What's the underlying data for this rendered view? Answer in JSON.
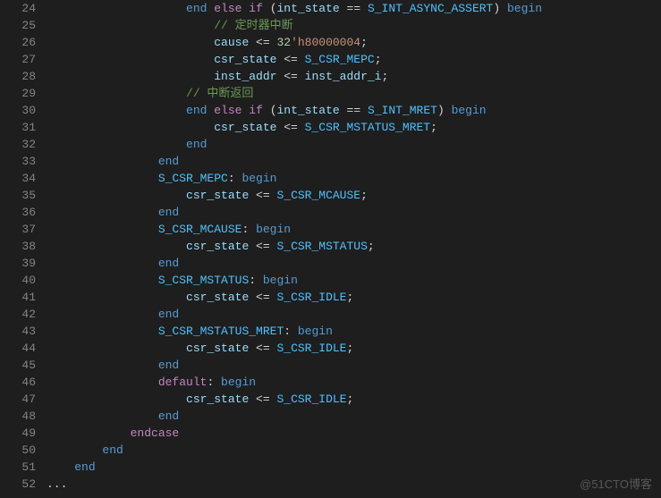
{
  "watermark": "@51CTO博客",
  "lines": [
    {
      "num": "24",
      "tokens": [
        {
          "t": "                    ",
          "c": "op"
        },
        {
          "t": "end",
          "c": "kw-blue"
        },
        {
          "t": " ",
          "c": "op"
        },
        {
          "t": "else",
          "c": "kw-pink"
        },
        {
          "t": " ",
          "c": "op"
        },
        {
          "t": "if",
          "c": "kw-pink"
        },
        {
          "t": " (",
          "c": "op"
        },
        {
          "t": "int_state",
          "c": "ident"
        },
        {
          "t": " == ",
          "c": "op"
        },
        {
          "t": "S_INT_ASYNC_ASSERT",
          "c": "const"
        },
        {
          "t": ") ",
          "c": "op"
        },
        {
          "t": "begin",
          "c": "kw-blue"
        }
      ]
    },
    {
      "num": "25",
      "tokens": [
        {
          "t": "                        ",
          "c": "op"
        },
        {
          "t": "// 定时器中断",
          "c": "comment"
        }
      ]
    },
    {
      "num": "26",
      "tokens": [
        {
          "t": "                        ",
          "c": "op"
        },
        {
          "t": "cause",
          "c": "ident"
        },
        {
          "t": " <= ",
          "c": "op"
        },
        {
          "t": "32",
          "c": "num"
        },
        {
          "t": "'h80000004",
          "c": "str"
        },
        {
          "t": ";",
          "c": "op"
        }
      ]
    },
    {
      "num": "27",
      "tokens": [
        {
          "t": "                        ",
          "c": "op"
        },
        {
          "t": "csr_state",
          "c": "ident"
        },
        {
          "t": " <= ",
          "c": "op"
        },
        {
          "t": "S_CSR_MEPC",
          "c": "const"
        },
        {
          "t": ";",
          "c": "op"
        }
      ]
    },
    {
      "num": "28",
      "tokens": [
        {
          "t": "                        ",
          "c": "op"
        },
        {
          "t": "inst_addr",
          "c": "ident"
        },
        {
          "t": " <= ",
          "c": "op"
        },
        {
          "t": "inst_addr_i",
          "c": "ident"
        },
        {
          "t": ";",
          "c": "op"
        }
      ]
    },
    {
      "num": "29",
      "tokens": [
        {
          "t": "                    ",
          "c": "op"
        },
        {
          "t": "// 中断返回",
          "c": "comment"
        }
      ]
    },
    {
      "num": "30",
      "tokens": [
        {
          "t": "                    ",
          "c": "op"
        },
        {
          "t": "end",
          "c": "kw-blue"
        },
        {
          "t": " ",
          "c": "op"
        },
        {
          "t": "else",
          "c": "kw-pink"
        },
        {
          "t": " ",
          "c": "op"
        },
        {
          "t": "if",
          "c": "kw-pink"
        },
        {
          "t": " (",
          "c": "op"
        },
        {
          "t": "int_state",
          "c": "ident"
        },
        {
          "t": " == ",
          "c": "op"
        },
        {
          "t": "S_INT_MRET",
          "c": "const"
        },
        {
          "t": ") ",
          "c": "op"
        },
        {
          "t": "begin",
          "c": "kw-blue"
        }
      ]
    },
    {
      "num": "31",
      "tokens": [
        {
          "t": "                        ",
          "c": "op"
        },
        {
          "t": "csr_state",
          "c": "ident"
        },
        {
          "t": " <= ",
          "c": "op"
        },
        {
          "t": "S_CSR_MSTATUS_MRET",
          "c": "const"
        },
        {
          "t": ";",
          "c": "op"
        }
      ]
    },
    {
      "num": "32",
      "tokens": [
        {
          "t": "                    ",
          "c": "op"
        },
        {
          "t": "end",
          "c": "kw-blue"
        }
      ]
    },
    {
      "num": "33",
      "tokens": [
        {
          "t": "                ",
          "c": "op"
        },
        {
          "t": "end",
          "c": "kw-blue"
        }
      ]
    },
    {
      "num": "34",
      "tokens": [
        {
          "t": "                ",
          "c": "op"
        },
        {
          "t": "S_CSR_MEPC",
          "c": "const"
        },
        {
          "t": ": ",
          "c": "op"
        },
        {
          "t": "begin",
          "c": "kw-blue"
        }
      ]
    },
    {
      "num": "35",
      "tokens": [
        {
          "t": "                    ",
          "c": "op"
        },
        {
          "t": "csr_state",
          "c": "ident"
        },
        {
          "t": " <= ",
          "c": "op"
        },
        {
          "t": "S_CSR_MCAUSE",
          "c": "const"
        },
        {
          "t": ";",
          "c": "op"
        }
      ]
    },
    {
      "num": "36",
      "tokens": [
        {
          "t": "                ",
          "c": "op"
        },
        {
          "t": "end",
          "c": "kw-blue"
        }
      ]
    },
    {
      "num": "37",
      "tokens": [
        {
          "t": "                ",
          "c": "op"
        },
        {
          "t": "S_CSR_MCAUSE",
          "c": "const"
        },
        {
          "t": ": ",
          "c": "op"
        },
        {
          "t": "begin",
          "c": "kw-blue"
        }
      ]
    },
    {
      "num": "38",
      "tokens": [
        {
          "t": "                    ",
          "c": "op"
        },
        {
          "t": "csr_state",
          "c": "ident"
        },
        {
          "t": " <= ",
          "c": "op"
        },
        {
          "t": "S_CSR_MSTATUS",
          "c": "const"
        },
        {
          "t": ";",
          "c": "op"
        }
      ]
    },
    {
      "num": "39",
      "tokens": [
        {
          "t": "                ",
          "c": "op"
        },
        {
          "t": "end",
          "c": "kw-blue"
        }
      ]
    },
    {
      "num": "40",
      "tokens": [
        {
          "t": "                ",
          "c": "op"
        },
        {
          "t": "S_CSR_MSTATUS",
          "c": "const"
        },
        {
          "t": ": ",
          "c": "op"
        },
        {
          "t": "begin",
          "c": "kw-blue"
        }
      ]
    },
    {
      "num": "41",
      "tokens": [
        {
          "t": "                    ",
          "c": "op"
        },
        {
          "t": "csr_state",
          "c": "ident"
        },
        {
          "t": " <= ",
          "c": "op"
        },
        {
          "t": "S_CSR_IDLE",
          "c": "const"
        },
        {
          "t": ";",
          "c": "op"
        }
      ]
    },
    {
      "num": "42",
      "tokens": [
        {
          "t": "                ",
          "c": "op"
        },
        {
          "t": "end",
          "c": "kw-blue"
        }
      ]
    },
    {
      "num": "43",
      "tokens": [
        {
          "t": "                ",
          "c": "op"
        },
        {
          "t": "S_CSR_MSTATUS_MRET",
          "c": "const"
        },
        {
          "t": ": ",
          "c": "op"
        },
        {
          "t": "begin",
          "c": "kw-blue"
        }
      ]
    },
    {
      "num": "44",
      "tokens": [
        {
          "t": "                    ",
          "c": "op"
        },
        {
          "t": "csr_state",
          "c": "ident"
        },
        {
          "t": " <= ",
          "c": "op"
        },
        {
          "t": "S_CSR_IDLE",
          "c": "const"
        },
        {
          "t": ";",
          "c": "op"
        }
      ]
    },
    {
      "num": "45",
      "tokens": [
        {
          "t": "                ",
          "c": "op"
        },
        {
          "t": "end",
          "c": "kw-blue"
        }
      ]
    },
    {
      "num": "46",
      "tokens": [
        {
          "t": "                ",
          "c": "op"
        },
        {
          "t": "default",
          "c": "kw-pink"
        },
        {
          "t": ": ",
          "c": "op"
        },
        {
          "t": "begin",
          "c": "kw-blue"
        }
      ]
    },
    {
      "num": "47",
      "tokens": [
        {
          "t": "                    ",
          "c": "op"
        },
        {
          "t": "csr_state",
          "c": "ident"
        },
        {
          "t": " <= ",
          "c": "op"
        },
        {
          "t": "S_CSR_IDLE",
          "c": "const"
        },
        {
          "t": ";",
          "c": "op"
        }
      ]
    },
    {
      "num": "48",
      "tokens": [
        {
          "t": "                ",
          "c": "op"
        },
        {
          "t": "end",
          "c": "kw-blue"
        }
      ]
    },
    {
      "num": "49",
      "tokens": [
        {
          "t": "            ",
          "c": "op"
        },
        {
          "t": "endcase",
          "c": "kw-pink"
        }
      ]
    },
    {
      "num": "50",
      "tokens": [
        {
          "t": "        ",
          "c": "op"
        },
        {
          "t": "end",
          "c": "kw-blue"
        }
      ]
    },
    {
      "num": "51",
      "tokens": [
        {
          "t": "    ",
          "c": "op"
        },
        {
          "t": "end",
          "c": "kw-blue"
        }
      ]
    },
    {
      "num": "52",
      "tokens": [
        {
          "t": "...",
          "c": "op"
        }
      ]
    }
  ]
}
